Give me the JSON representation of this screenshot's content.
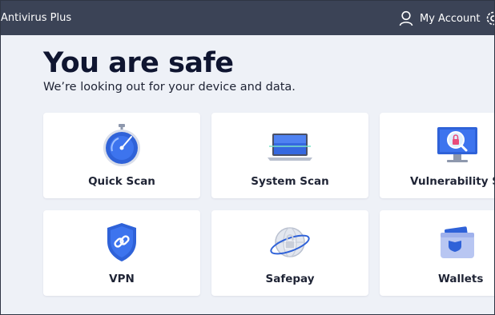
{
  "app": {
    "title": "Antivirus Plus"
  },
  "header": {
    "account_label": "My Account"
  },
  "status": {
    "title": "You are safe",
    "subtitle": "We’re looking out for your device and data."
  },
  "features": [
    {
      "label": "Quick Scan",
      "icon": "stopwatch-icon"
    },
    {
      "label": "System Scan",
      "icon": "laptop-icon"
    },
    {
      "label": "Vulnerability Scan",
      "icon": "monitor-lock-icon"
    },
    {
      "label": "VPN",
      "icon": "shield-link-icon"
    },
    {
      "label": "Safepay",
      "icon": "globe-lock-icon"
    },
    {
      "label": "Wallets",
      "icon": "wallet-icon"
    }
  ],
  "colors": {
    "topbar": "#3b4356",
    "background": "#eef1f7",
    "accent": "#2f62d8"
  }
}
